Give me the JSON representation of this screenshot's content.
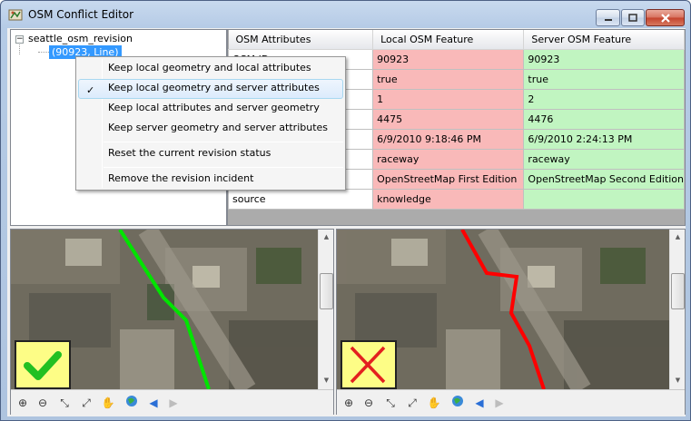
{
  "window": {
    "title": "OSM Conflict Editor"
  },
  "tree": {
    "expander": "⊟",
    "root_label": "seattle_osm_revision",
    "child_label": "(90923, Line)"
  },
  "grid": {
    "columns": [
      "OSM Attributes",
      "Local OSM Feature",
      "Server OSM Feature"
    ],
    "rows": [
      {
        "attr": "OSM ID",
        "local": "90923",
        "server": "90923"
      },
      {
        "attr": "",
        "local": "true",
        "server": "true"
      },
      {
        "attr": "",
        "local": "1",
        "server": "2"
      },
      {
        "attr": "",
        "local": "4475",
        "server": "4476"
      },
      {
        "attr": "",
        "local": "6/9/2010 9:18:46 PM",
        "server": "6/9/2010 2:24:13 PM"
      },
      {
        "attr": "",
        "local": "raceway",
        "server": "raceway"
      },
      {
        "attr": "",
        "local": "OpenStreetMap First Edition",
        "server": "OpenStreetMap Second Edition"
      },
      {
        "attr": "source",
        "local": "knowledge",
        "server": ""
      }
    ],
    "colors": {
      "local": "#f9b9b9",
      "server": "#c1f5c1"
    }
  },
  "menu": {
    "items": [
      {
        "label": "Keep local geometry and local attributes",
        "checked": false
      },
      {
        "label": "Keep local geometry and server attributes",
        "checked": true
      },
      {
        "label": "Keep local attributes and server geometry",
        "checked": false
      },
      {
        "label": "Keep server geometry and server attributes",
        "checked": false
      }
    ],
    "reset_label": "Reset the current revision status",
    "remove_label": "Remove the revision incident",
    "check_glyph": "✓"
  },
  "maps": {
    "left": {
      "line_color": "#00e400",
      "status": "accepted"
    },
    "right": {
      "line_color": "#ff0000",
      "status": "rejected"
    }
  }
}
